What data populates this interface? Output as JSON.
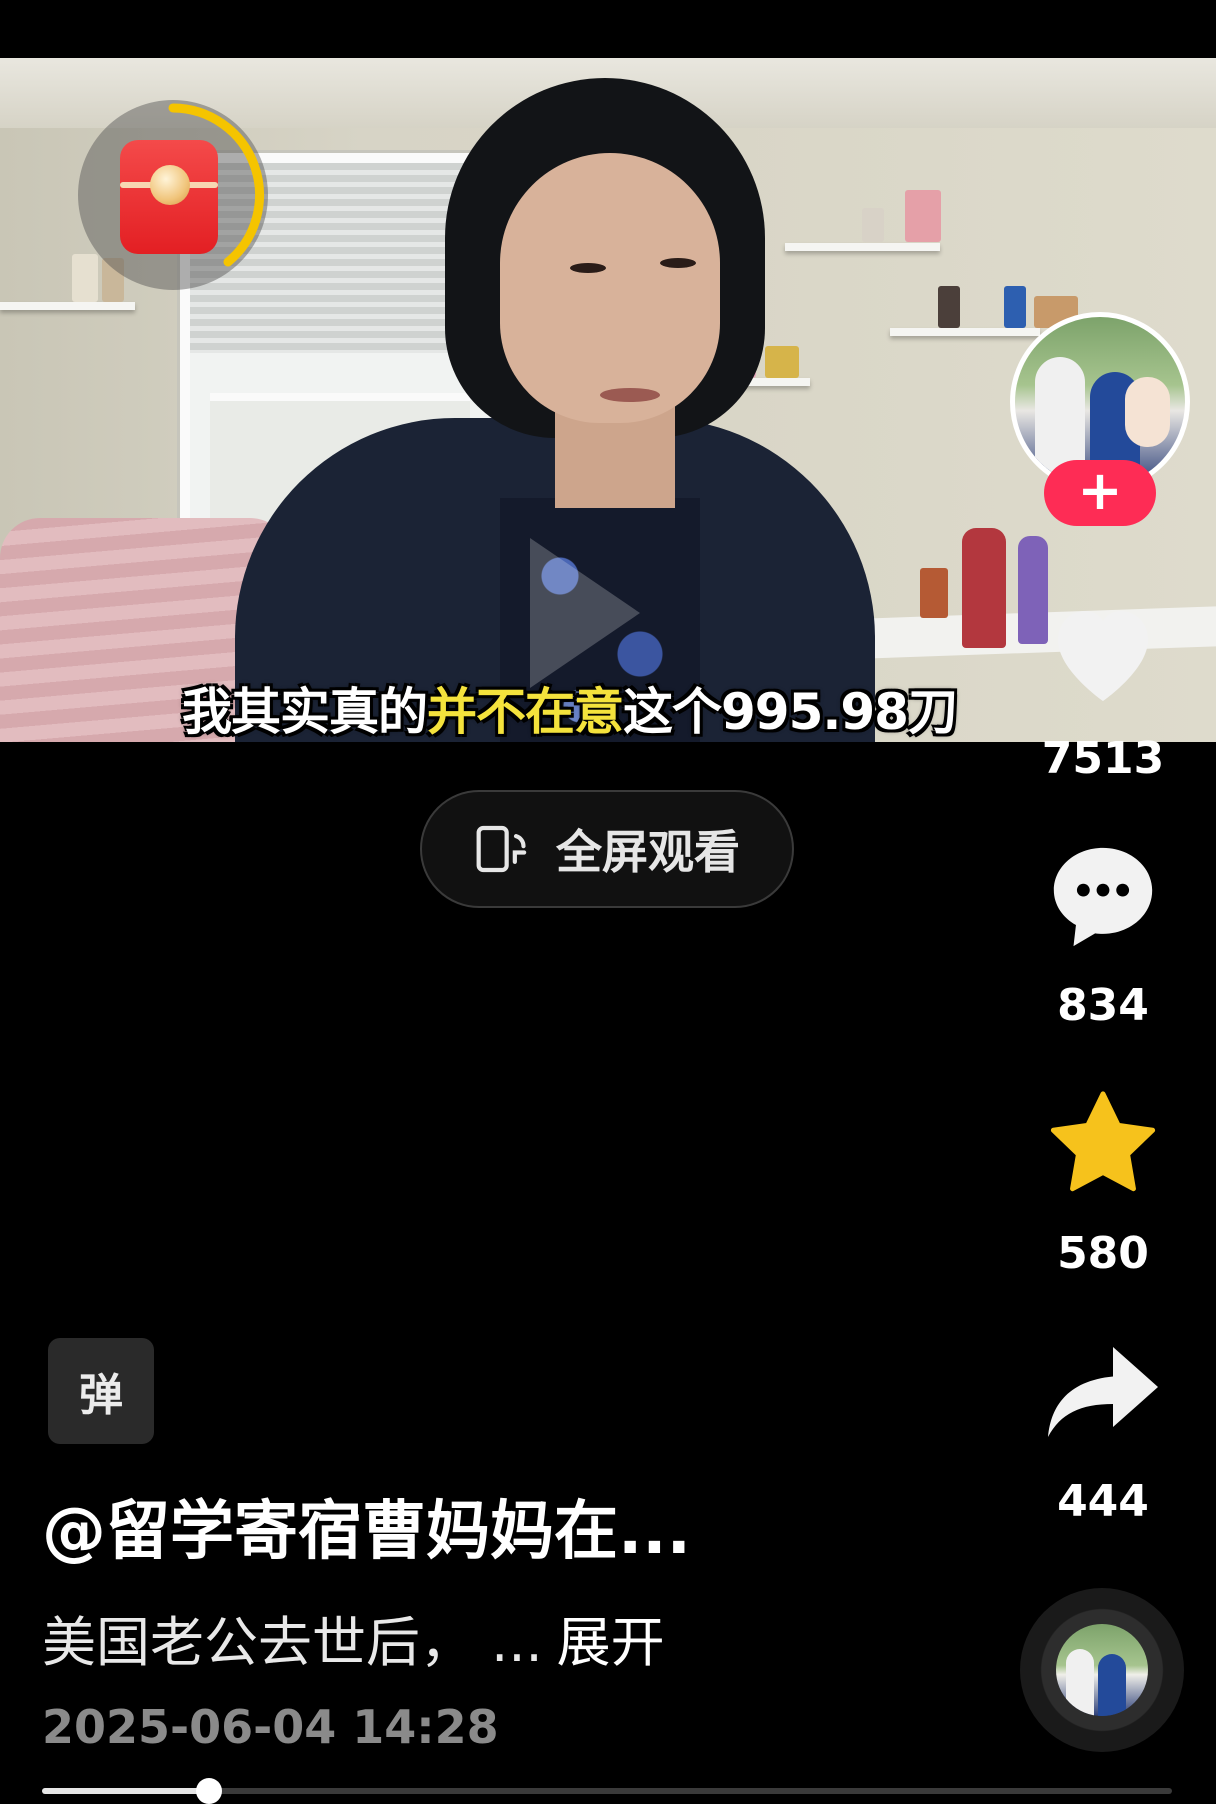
{
  "video": {
    "subtitle": {
      "part1": "我其实真的",
      "highlight": "并不在意",
      "part2": "这个995.98刀"
    }
  },
  "red_packet": {
    "icon": "red-envelope-icon",
    "accent": "#e31f23",
    "ring_color": "#f5c400"
  },
  "fullscreen_button": {
    "icon": "rotate-screen-icon",
    "label": "全屏观看"
  },
  "right_rail": {
    "follow_icon": "plus-icon",
    "follow_color": "#fe2c55",
    "like": {
      "icon": "heart-icon",
      "count": "7513"
    },
    "comment": {
      "icon": "comment-bubble-icon",
      "count": "834"
    },
    "favorite": {
      "icon": "star-icon",
      "count": "580",
      "color": "#f6c21c"
    },
    "share": {
      "icon": "share-arrow-icon",
      "count": "444"
    },
    "music": {
      "icon": "music-disc-icon"
    }
  },
  "info": {
    "badge": "弹",
    "author": "@留学寄宿曹妈妈在...",
    "description": "美国老公去世后， ...",
    "expand": "展开",
    "date": "2025-06-04 14:28"
  },
  "playback": {
    "progress": 0.148
  }
}
